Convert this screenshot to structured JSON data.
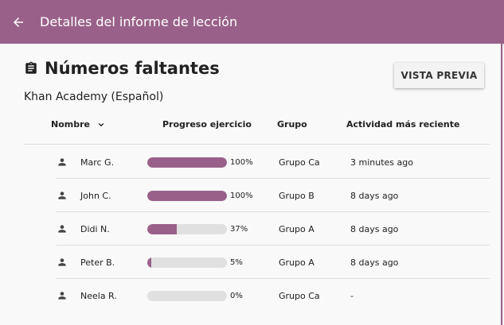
{
  "appbar": {
    "title": "Detalles del informe de lección",
    "back_icon": "arrow-left-icon",
    "color": "#996189"
  },
  "page": {
    "title": "Números faltantes",
    "title_icon": "clipboard-icon",
    "channel": "Khan Academy (Español)",
    "preview_button": "VISTA PREVIA"
  },
  "table": {
    "columns": {
      "name": "Nombre",
      "progress": "Progreso ejercicio",
      "group": "Grupo",
      "activity": "Actividad más reciente"
    },
    "sort_icon": "chevron-down-icon",
    "rows": [
      {
        "name": "Marc G.",
        "progress": 1.0,
        "progress_label": "100%",
        "group": "Grupo Ca",
        "activity": "3 minutes ago"
      },
      {
        "name": "John C.",
        "progress": 1.0,
        "progress_label": "100%",
        "group": "Grupo B",
        "activity": "8 days ago"
      },
      {
        "name": "Didi N.",
        "progress": 0.37,
        "progress_label": "37%",
        "group": "Grupo A",
        "activity": "8 days ago"
      },
      {
        "name": "Peter B.",
        "progress": 0.05,
        "progress_label": "5%",
        "group": "Grupo A",
        "activity": "8 days ago"
      },
      {
        "name": "Neela R.",
        "progress": 0.0,
        "progress_label": "0%",
        "group": "Grupo Ca",
        "activity": "-"
      }
    ]
  }
}
